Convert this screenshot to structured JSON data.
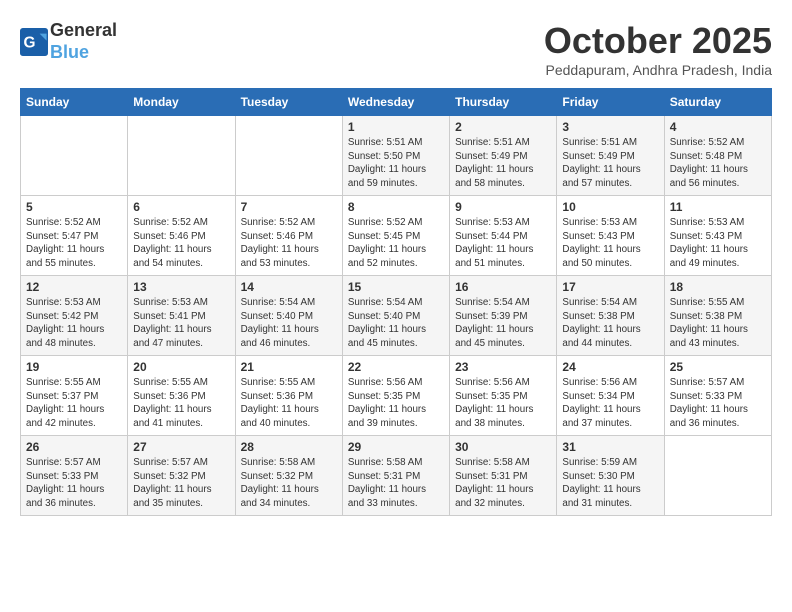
{
  "header": {
    "logo_line1": "General",
    "logo_line2": "Blue",
    "month": "October 2025",
    "location": "Peddapuram, Andhra Pradesh, India"
  },
  "days_of_week": [
    "Sunday",
    "Monday",
    "Tuesday",
    "Wednesday",
    "Thursday",
    "Friday",
    "Saturday"
  ],
  "weeks": [
    [
      {
        "day": "",
        "info": ""
      },
      {
        "day": "",
        "info": ""
      },
      {
        "day": "",
        "info": ""
      },
      {
        "day": "1",
        "info": "Sunrise: 5:51 AM\nSunset: 5:50 PM\nDaylight: 11 hours\nand 59 minutes."
      },
      {
        "day": "2",
        "info": "Sunrise: 5:51 AM\nSunset: 5:49 PM\nDaylight: 11 hours\nand 58 minutes."
      },
      {
        "day": "3",
        "info": "Sunrise: 5:51 AM\nSunset: 5:49 PM\nDaylight: 11 hours\nand 57 minutes."
      },
      {
        "day": "4",
        "info": "Sunrise: 5:52 AM\nSunset: 5:48 PM\nDaylight: 11 hours\nand 56 minutes."
      }
    ],
    [
      {
        "day": "5",
        "info": "Sunrise: 5:52 AM\nSunset: 5:47 PM\nDaylight: 11 hours\nand 55 minutes."
      },
      {
        "day": "6",
        "info": "Sunrise: 5:52 AM\nSunset: 5:46 PM\nDaylight: 11 hours\nand 54 minutes."
      },
      {
        "day": "7",
        "info": "Sunrise: 5:52 AM\nSunset: 5:46 PM\nDaylight: 11 hours\nand 53 minutes."
      },
      {
        "day": "8",
        "info": "Sunrise: 5:52 AM\nSunset: 5:45 PM\nDaylight: 11 hours\nand 52 minutes."
      },
      {
        "day": "9",
        "info": "Sunrise: 5:53 AM\nSunset: 5:44 PM\nDaylight: 11 hours\nand 51 minutes."
      },
      {
        "day": "10",
        "info": "Sunrise: 5:53 AM\nSunset: 5:43 PM\nDaylight: 11 hours\nand 50 minutes."
      },
      {
        "day": "11",
        "info": "Sunrise: 5:53 AM\nSunset: 5:43 PM\nDaylight: 11 hours\nand 49 minutes."
      }
    ],
    [
      {
        "day": "12",
        "info": "Sunrise: 5:53 AM\nSunset: 5:42 PM\nDaylight: 11 hours\nand 48 minutes."
      },
      {
        "day": "13",
        "info": "Sunrise: 5:53 AM\nSunset: 5:41 PM\nDaylight: 11 hours\nand 47 minutes."
      },
      {
        "day": "14",
        "info": "Sunrise: 5:54 AM\nSunset: 5:40 PM\nDaylight: 11 hours\nand 46 minutes."
      },
      {
        "day": "15",
        "info": "Sunrise: 5:54 AM\nSunset: 5:40 PM\nDaylight: 11 hours\nand 45 minutes."
      },
      {
        "day": "16",
        "info": "Sunrise: 5:54 AM\nSunset: 5:39 PM\nDaylight: 11 hours\nand 45 minutes."
      },
      {
        "day": "17",
        "info": "Sunrise: 5:54 AM\nSunset: 5:38 PM\nDaylight: 11 hours\nand 44 minutes."
      },
      {
        "day": "18",
        "info": "Sunrise: 5:55 AM\nSunset: 5:38 PM\nDaylight: 11 hours\nand 43 minutes."
      }
    ],
    [
      {
        "day": "19",
        "info": "Sunrise: 5:55 AM\nSunset: 5:37 PM\nDaylight: 11 hours\nand 42 minutes."
      },
      {
        "day": "20",
        "info": "Sunrise: 5:55 AM\nSunset: 5:36 PM\nDaylight: 11 hours\nand 41 minutes."
      },
      {
        "day": "21",
        "info": "Sunrise: 5:55 AM\nSunset: 5:36 PM\nDaylight: 11 hours\nand 40 minutes."
      },
      {
        "day": "22",
        "info": "Sunrise: 5:56 AM\nSunset: 5:35 PM\nDaylight: 11 hours\nand 39 minutes."
      },
      {
        "day": "23",
        "info": "Sunrise: 5:56 AM\nSunset: 5:35 PM\nDaylight: 11 hours\nand 38 minutes."
      },
      {
        "day": "24",
        "info": "Sunrise: 5:56 AM\nSunset: 5:34 PM\nDaylight: 11 hours\nand 37 minutes."
      },
      {
        "day": "25",
        "info": "Sunrise: 5:57 AM\nSunset: 5:33 PM\nDaylight: 11 hours\nand 36 minutes."
      }
    ],
    [
      {
        "day": "26",
        "info": "Sunrise: 5:57 AM\nSunset: 5:33 PM\nDaylight: 11 hours\nand 36 minutes."
      },
      {
        "day": "27",
        "info": "Sunrise: 5:57 AM\nSunset: 5:32 PM\nDaylight: 11 hours\nand 35 minutes."
      },
      {
        "day": "28",
        "info": "Sunrise: 5:58 AM\nSunset: 5:32 PM\nDaylight: 11 hours\nand 34 minutes."
      },
      {
        "day": "29",
        "info": "Sunrise: 5:58 AM\nSunset: 5:31 PM\nDaylight: 11 hours\nand 33 minutes."
      },
      {
        "day": "30",
        "info": "Sunrise: 5:58 AM\nSunset: 5:31 PM\nDaylight: 11 hours\nand 32 minutes."
      },
      {
        "day": "31",
        "info": "Sunrise: 5:59 AM\nSunset: 5:30 PM\nDaylight: 11 hours\nand 31 minutes."
      },
      {
        "day": "",
        "info": ""
      }
    ]
  ]
}
